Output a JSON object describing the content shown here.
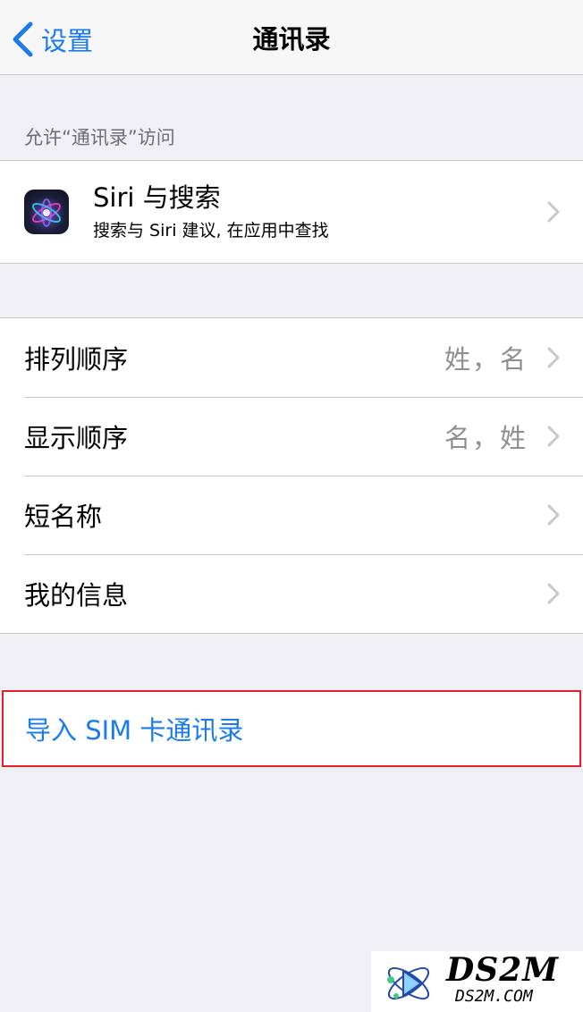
{
  "navbar": {
    "back_label": "设置",
    "title": "通讯录"
  },
  "section_header": "允许“通讯录”访问",
  "siri": {
    "title": "Siri 与搜索",
    "subtitle": "搜索与 Siri 建议, 在应用中查找",
    "icon": "siri-icon"
  },
  "settings": [
    {
      "label": "排列顺序",
      "value": "姓，名"
    },
    {
      "label": "显示顺序",
      "value": "名，姓"
    },
    {
      "label": "短名称",
      "value": ""
    },
    {
      "label": "我的信息",
      "value": ""
    }
  ],
  "import_sim": "导入 SIM 卡通讯录",
  "watermark": {
    "title": "DS2M",
    "subtitle": "DS2M.COM"
  },
  "colors": {
    "accent": "#1a7bf0",
    "highlight_border": "#e5202a",
    "background": "#efeff4"
  }
}
